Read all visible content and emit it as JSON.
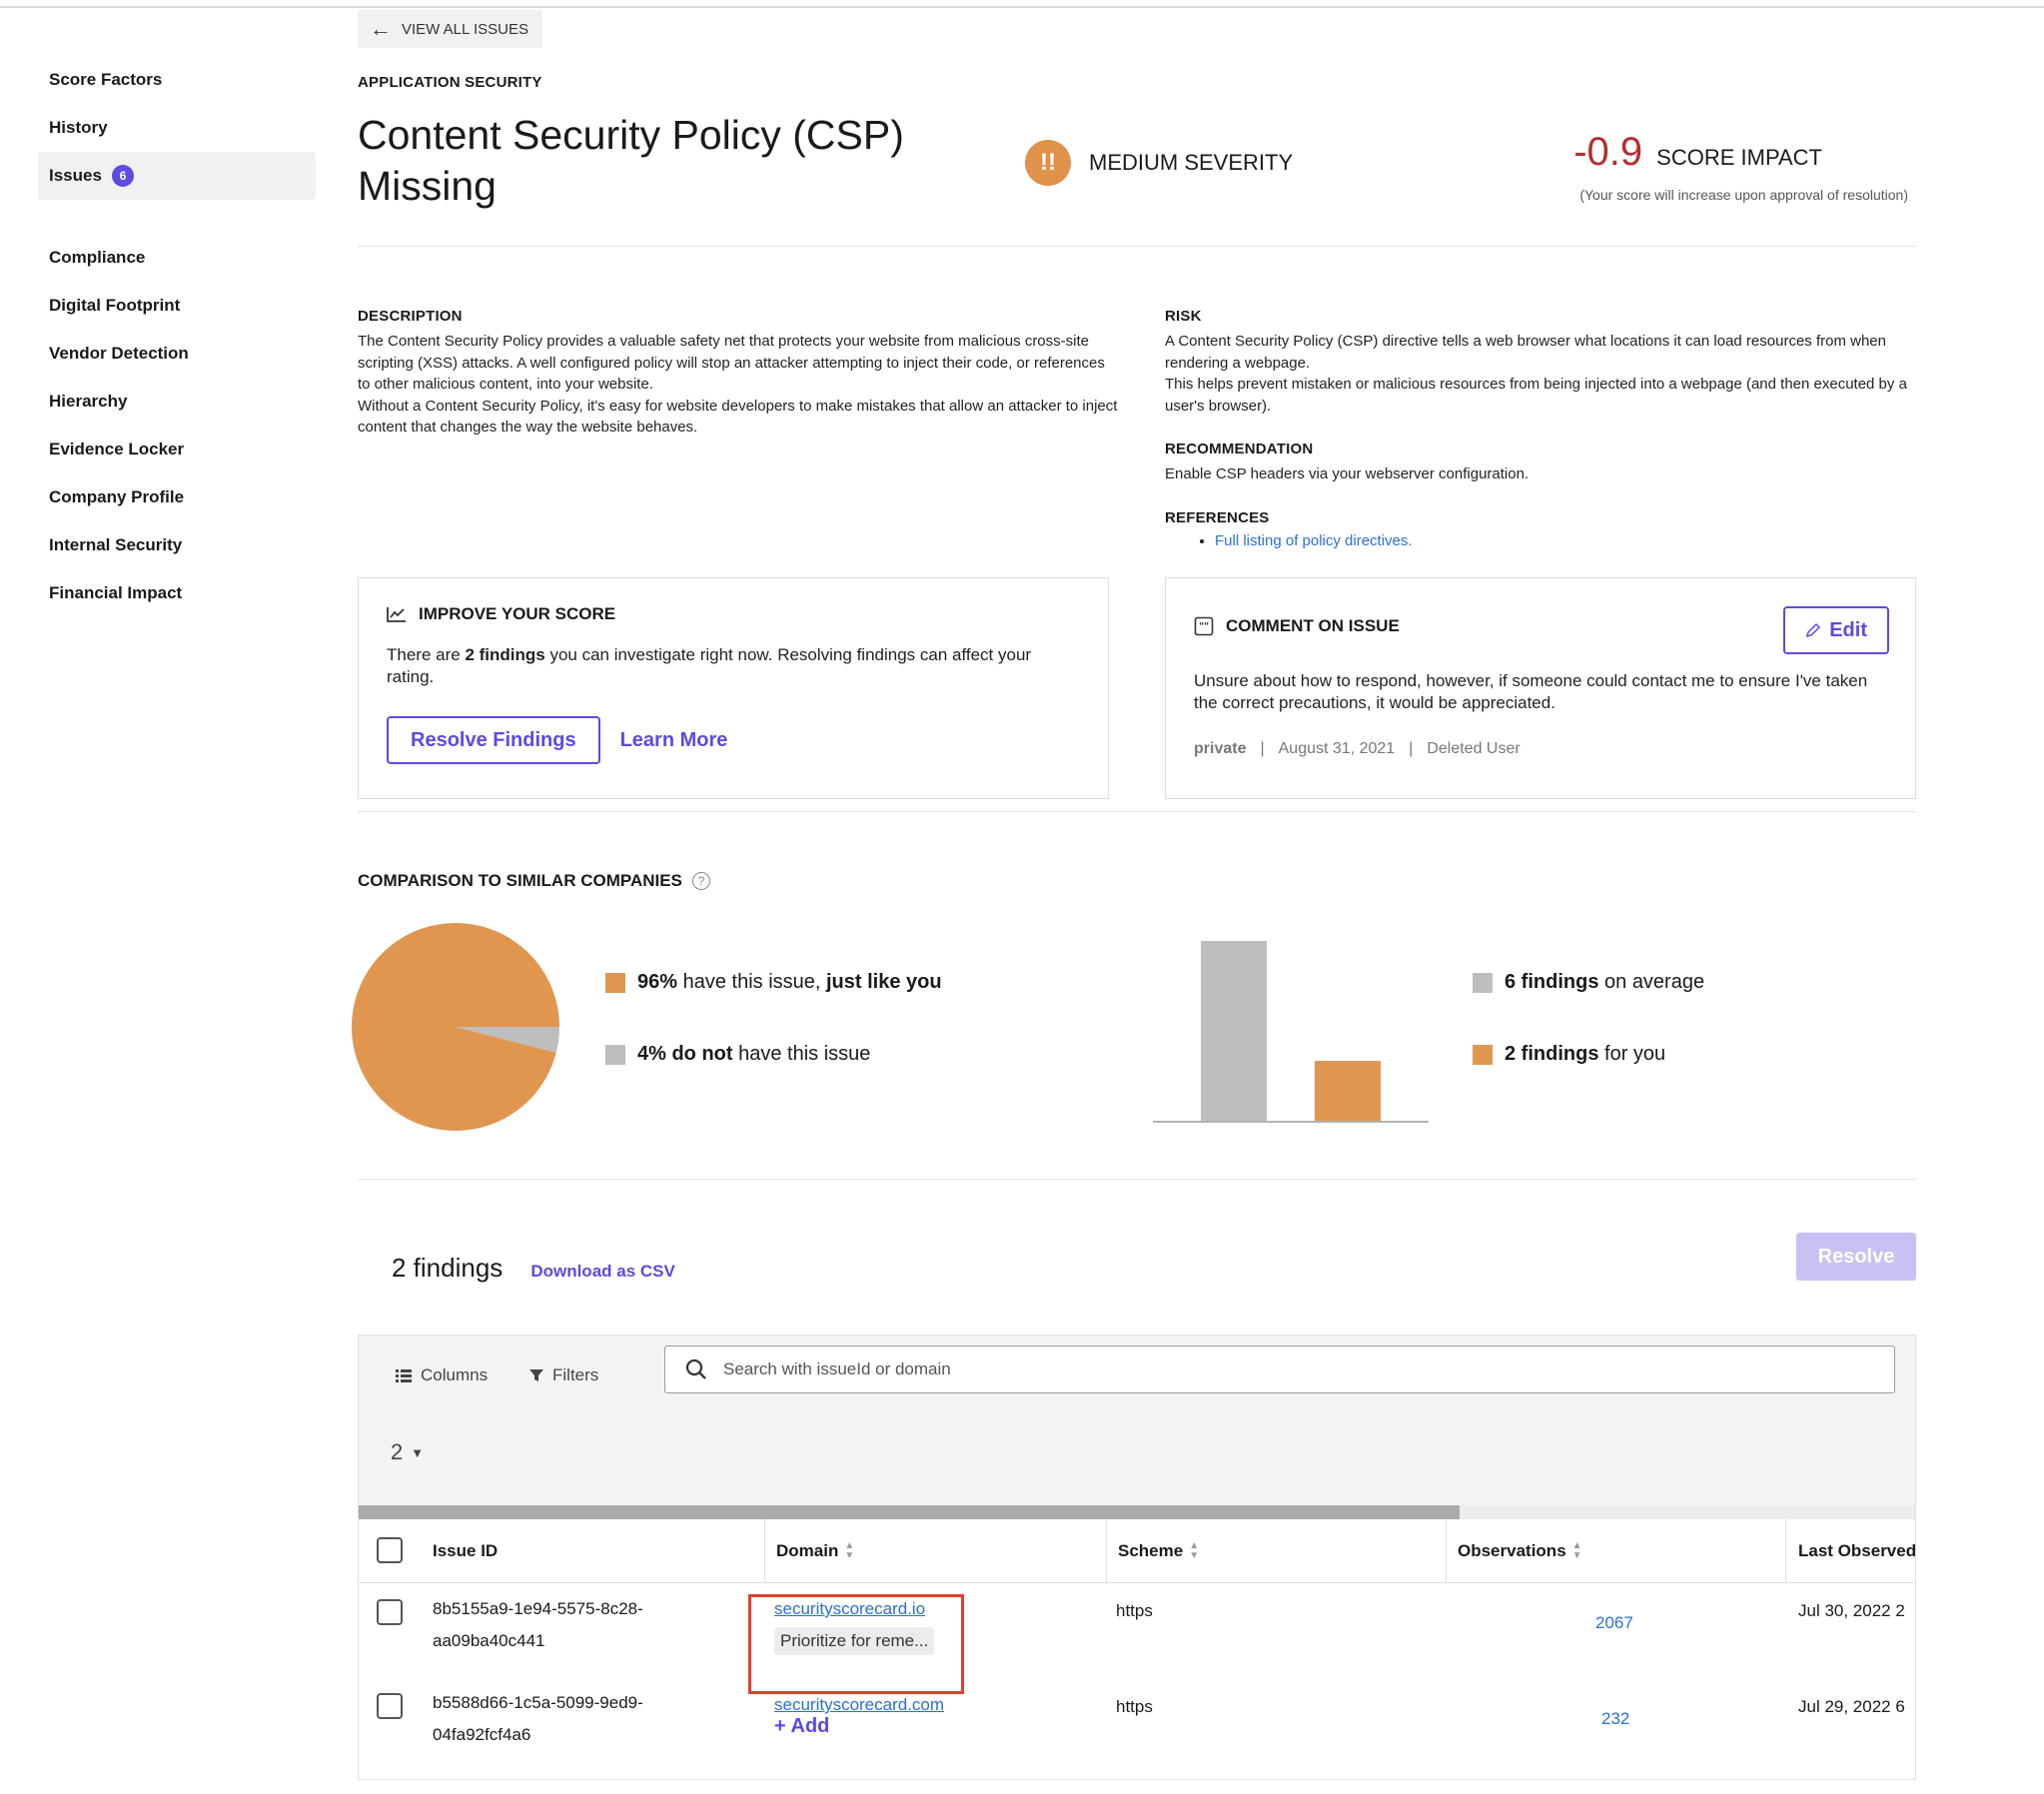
{
  "sidebar": {
    "items": [
      {
        "label": "Score Factors",
        "active": false
      },
      {
        "label": "History",
        "active": false
      },
      {
        "label": "Issues",
        "active": true,
        "badge": "6"
      }
    ],
    "items2": [
      {
        "label": "Compliance"
      },
      {
        "label": "Digital Footprint"
      },
      {
        "label": "Vendor Detection"
      },
      {
        "label": "Hierarchy"
      },
      {
        "label": "Evidence Locker"
      },
      {
        "label": "Company Profile"
      },
      {
        "label": "Internal Security"
      },
      {
        "label": "Financial Impact"
      }
    ]
  },
  "header": {
    "back_label": "VIEW ALL ISSUES",
    "category": "APPLICATION SECURITY",
    "title": "Content Security Policy (CSP) Missing",
    "severity_icon": "!!",
    "severity": "MEDIUM SEVERITY",
    "impact_value": "-0.9",
    "impact_label": "SCORE IMPACT",
    "impact_note": "(Your score will increase upon approval of resolution)"
  },
  "description": {
    "heading": "DESCRIPTION",
    "text": "The Content Security Policy provides a valuable safety net that protects your website from malicious cross-site scripting (XSS) attacks. A well configured policy will stop an attacker attempting to inject their code, or references to other malicious content, into your website.",
    "text2": "Without a Content Security Policy, it's easy for website developers to make mistakes that allow an attacker to inject content that changes the way the website behaves."
  },
  "risk": {
    "heading": "RISK",
    "text": "A Content Security Policy (CSP) directive tells a web browser what locations it can load resources from when rendering a webpage.",
    "text2": "This helps prevent mistaken or malicious resources from being injected into a webpage (and then executed by a user's browser).",
    "rec_heading": "RECOMMENDATION",
    "rec_text": "Enable CSP headers via your webserver configuration.",
    "refs_heading": "REFERENCES",
    "ref_link": "Full listing of policy directives."
  },
  "improve": {
    "heading": "IMPROVE YOUR SCORE",
    "text_pre": "There are ",
    "text_bold": "2 findings",
    "text_post": " you can investigate right now. Resolving findings can affect your rating.",
    "resolve_label": "Resolve Findings",
    "learn_label": "Learn More"
  },
  "comment": {
    "heading": "COMMENT ON ISSUE",
    "edit_label": "Edit",
    "text": "Unsure about how to respond, however, if someone could contact me to ensure I've taken the correct precautions, it would be appreciated.",
    "visibility": "private",
    "date": "August 31, 2021",
    "author": "Deleted User",
    "sep": "|"
  },
  "comparison": {
    "heading": "COMPARISON TO SIMILAR COMPANIES",
    "help": "?",
    "pie_have_bold": "96%",
    "pie_have_text": " have this issue, ",
    "pie_have_bold2": "just like you",
    "pie_not_bold": "4% do not",
    "pie_not_text": " have this issue",
    "avg_bold": "6 findings",
    "avg_text": " on average",
    "you_bold": "2 findings",
    "you_text": " for you"
  },
  "chart_data": [
    {
      "type": "pie",
      "categories": [
        "have this issue",
        "do not have this issue"
      ],
      "values": [
        96,
        4
      ],
      "colors": [
        "#e0964f",
        "#bdbdbd"
      ]
    },
    {
      "type": "bar",
      "categories": [
        "on average",
        "for you"
      ],
      "values": [
        6,
        2
      ],
      "ylim": [
        0,
        6
      ],
      "colors": [
        "#bdbdbd",
        "#e0964f"
      ]
    }
  ],
  "findings": {
    "count_label": "2 findings",
    "csv_label": "Download as CSV",
    "resolve_label": "Resolve",
    "columns_label": "Columns",
    "filters_label": "Filters",
    "search_placeholder": "Search with issueId or domain",
    "page_size": "2",
    "headers": [
      "Issue ID",
      "Domain",
      "Scheme",
      "Observations",
      "Last Observed"
    ],
    "rows": [
      {
        "issue_id_1": "8b5155a9-1e94-5575-8c28-",
        "issue_id_2": "aa09ba40c441",
        "domain": "securityscorecard.io",
        "chip": "Prioritize for reme...",
        "scheme": "https",
        "observations": "2067",
        "last_observed": "Jul 30, 2022 2"
      },
      {
        "issue_id_1": "b5588d66-1c5a-5099-9ed9-",
        "issue_id_2": "04fa92fcf4a6",
        "domain": "securityscorecard.com",
        "add_label": "+ Add",
        "scheme": "https",
        "observations": "232",
        "last_observed": "Jul 29, 2022 6"
      }
    ]
  },
  "colors": {
    "accent": "#5b4be0",
    "impact": "#b32f2f",
    "severity": "#e0914a",
    "link": "#2b6fd6",
    "highlight": "#e33d2f"
  }
}
